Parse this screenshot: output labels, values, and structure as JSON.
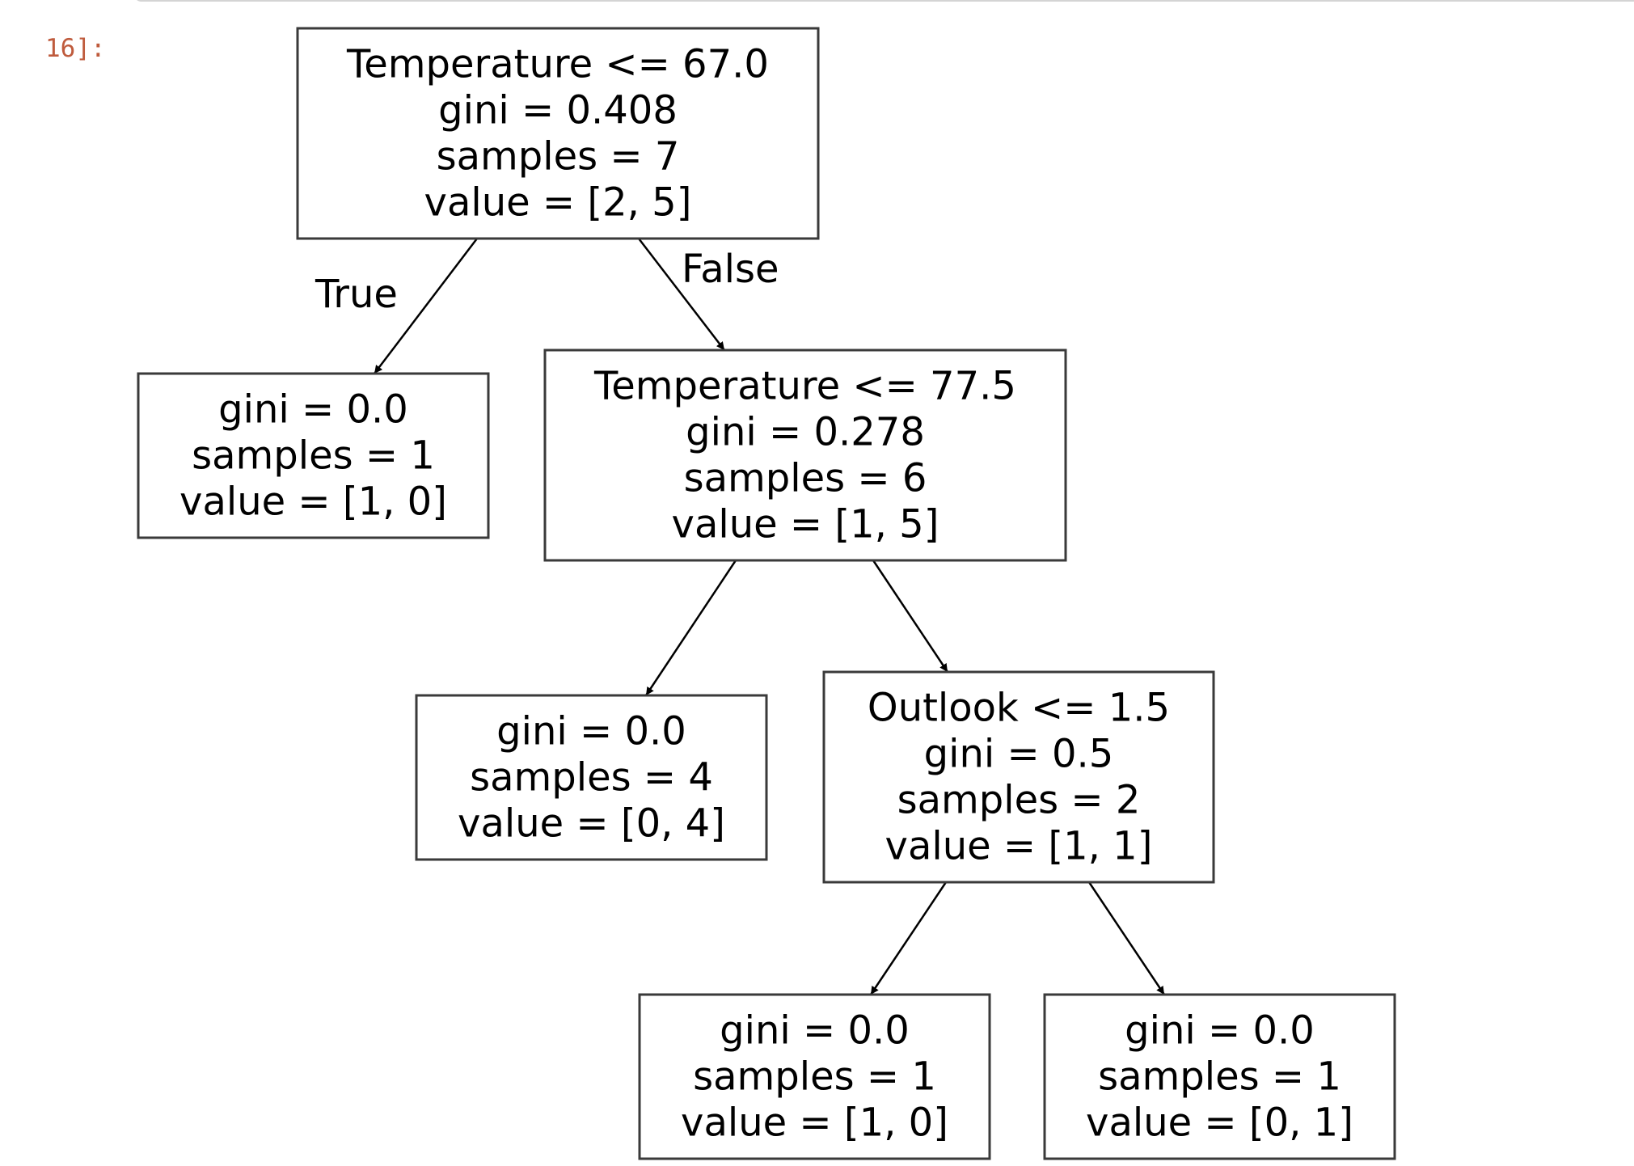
{
  "prompt": "16]:",
  "tree": {
    "nodes": [
      {
        "id": "root",
        "lines": [
          "Temperature <= 67.0",
          "gini = 0.408",
          "samples = 7",
          "value = [2, 5]"
        ]
      },
      {
        "id": "leaf1",
        "lines": [
          "gini = 0.0",
          "samples = 1",
          "value = [1, 0]"
        ]
      },
      {
        "id": "split2",
        "lines": [
          "Temperature <= 77.5",
          "gini = 0.278",
          "samples = 6",
          "value = [1, 5]"
        ]
      },
      {
        "id": "leaf2",
        "lines": [
          "gini = 0.0",
          "samples = 4",
          "value = [0, 4]"
        ]
      },
      {
        "id": "split3",
        "lines": [
          "Outlook <= 1.5",
          "gini = 0.5",
          "samples = 2",
          "value = [1, 1]"
        ]
      },
      {
        "id": "leaf3",
        "lines": [
          "gini = 0.0",
          "samples = 1",
          "value = [1, 0]"
        ]
      },
      {
        "id": "leaf4",
        "lines": [
          "gini = 0.0",
          "samples = 1",
          "value = [0, 1]"
        ]
      }
    ],
    "edges": [
      {
        "from": "root",
        "to": "leaf1",
        "label": "True"
      },
      {
        "from": "root",
        "to": "split2",
        "label": "False"
      },
      {
        "from": "split2",
        "to": "leaf2",
        "label": ""
      },
      {
        "from": "split2",
        "to": "split3",
        "label": ""
      },
      {
        "from": "split3",
        "to": "leaf3",
        "label": ""
      },
      {
        "from": "split3",
        "to": "leaf4",
        "label": ""
      }
    ]
  }
}
